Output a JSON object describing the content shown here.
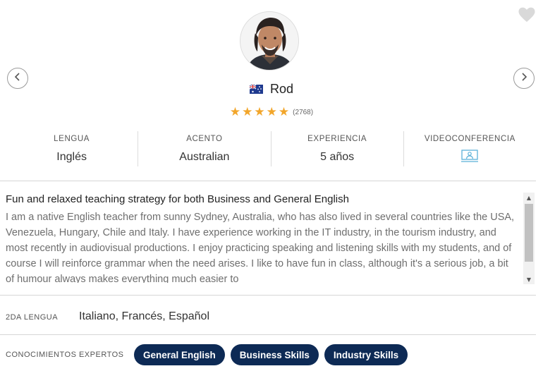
{
  "teacher": {
    "name": "Rod",
    "review_count": "(2768)",
    "rating_stars": 5
  },
  "icons": {
    "heart": "heart-icon",
    "prev": "chevron-left-icon",
    "next": "chevron-right-icon",
    "flag": "australia-flag-icon",
    "star": "star-icon",
    "video": "videoconference-icon"
  },
  "stats": [
    {
      "label": "LENGUA",
      "value": "Inglés"
    },
    {
      "label": "ACENTO",
      "value": "Australian"
    },
    {
      "label": "EXPERIENCIA",
      "value": "5 años"
    },
    {
      "label": "VIDEOCONFERENCIA",
      "value": ""
    }
  ],
  "description": {
    "title": "Fun and relaxed teaching strategy for both Business and General English",
    "text": "I am a native English teacher from sunny Sydney, Australia, who has also lived in several countries like the USA, Venezuela, Hungary, Chile and Italy. I have experience working in the IT industry, in the tourism industry, and most recently in audiovisual productions. I enjoy practicing speaking and listening skills with my students, and of course I will reinforce grammar when the need arises. I like to have fun in class, although it's a serious job, a bit of humour always makes everything much easier to"
  },
  "second_language": {
    "label": "2DA LENGUA",
    "value": "Italiano, Francés, Español"
  },
  "expertise": {
    "label": "CONOCIMIENTOS EXPERTOS",
    "skills": [
      "General English",
      "Business Skills",
      "Industry Skills"
    ]
  },
  "colors": {
    "star": "#f2a62b",
    "chip_bg": "#0d2a55",
    "video_icon": "#5bb0d8",
    "heart": "#d9d9d9"
  }
}
